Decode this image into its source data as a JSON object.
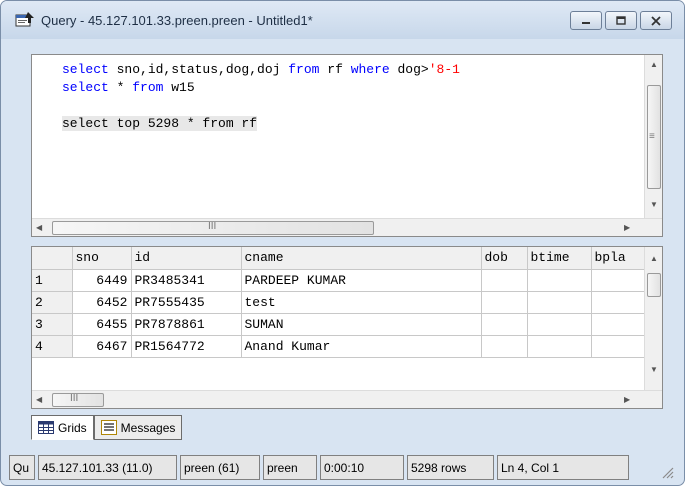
{
  "window": {
    "title": "Query - 45.127.101.33.preen.preen - Untitled1*"
  },
  "editor": {
    "lines": [
      {
        "tokens": [
          {
            "t": "select",
            "c": "kw"
          },
          {
            "t": " sno,id,status,dog,doj ",
            "c": "plain"
          },
          {
            "t": "from",
            "c": "kw"
          },
          {
            "t": " rf ",
            "c": "plain"
          },
          {
            "t": "where",
            "c": "kw"
          },
          {
            "t": " dog>",
            "c": "plain"
          },
          {
            "t": "'8-1",
            "c": "str"
          }
        ]
      },
      {
        "tokens": [
          {
            "t": "select",
            "c": "kw"
          },
          {
            "t": " * ",
            "c": "plain"
          },
          {
            "t": "from",
            "c": "kw"
          },
          {
            "t": " w15",
            "c": "plain"
          }
        ]
      },
      {
        "tokens": []
      },
      {
        "highlight": true,
        "tokens": [
          {
            "t": "select top 5298 * from rf",
            "c": "plain"
          }
        ]
      }
    ]
  },
  "results": {
    "columns": [
      "sno",
      "id",
      "cname",
      "dob",
      "btime",
      "bpla"
    ],
    "rows": [
      {
        "rownum": "1",
        "cells": [
          "6449",
          "PR3485341",
          "PARDEEP KUMAR",
          "",
          "",
          ""
        ]
      },
      {
        "rownum": "2",
        "cells": [
          "6452",
          "PR7555435",
          "test",
          "",
          "",
          ""
        ]
      },
      {
        "rownum": "3",
        "cells": [
          "6455",
          "PR7878861",
          "SUMAN",
          "",
          "",
          ""
        ]
      },
      {
        "rownum": "4",
        "cells": [
          "6467",
          "PR1564772",
          "Anand Kumar",
          "",
          "",
          ""
        ]
      }
    ]
  },
  "tabs": [
    {
      "label": "Grids",
      "icon": "grid-icon",
      "active": true
    },
    {
      "label": "Messages",
      "icon": "messages-icon",
      "active": false
    }
  ],
  "statusbar": {
    "cells": [
      "Qu",
      "45.127.101.33 (11.0)",
      "preen (61)",
      "preen",
      "0:00:10",
      "5298 rows",
      "Ln 4, Col 1"
    ]
  },
  "scrollbar_grip": "III"
}
